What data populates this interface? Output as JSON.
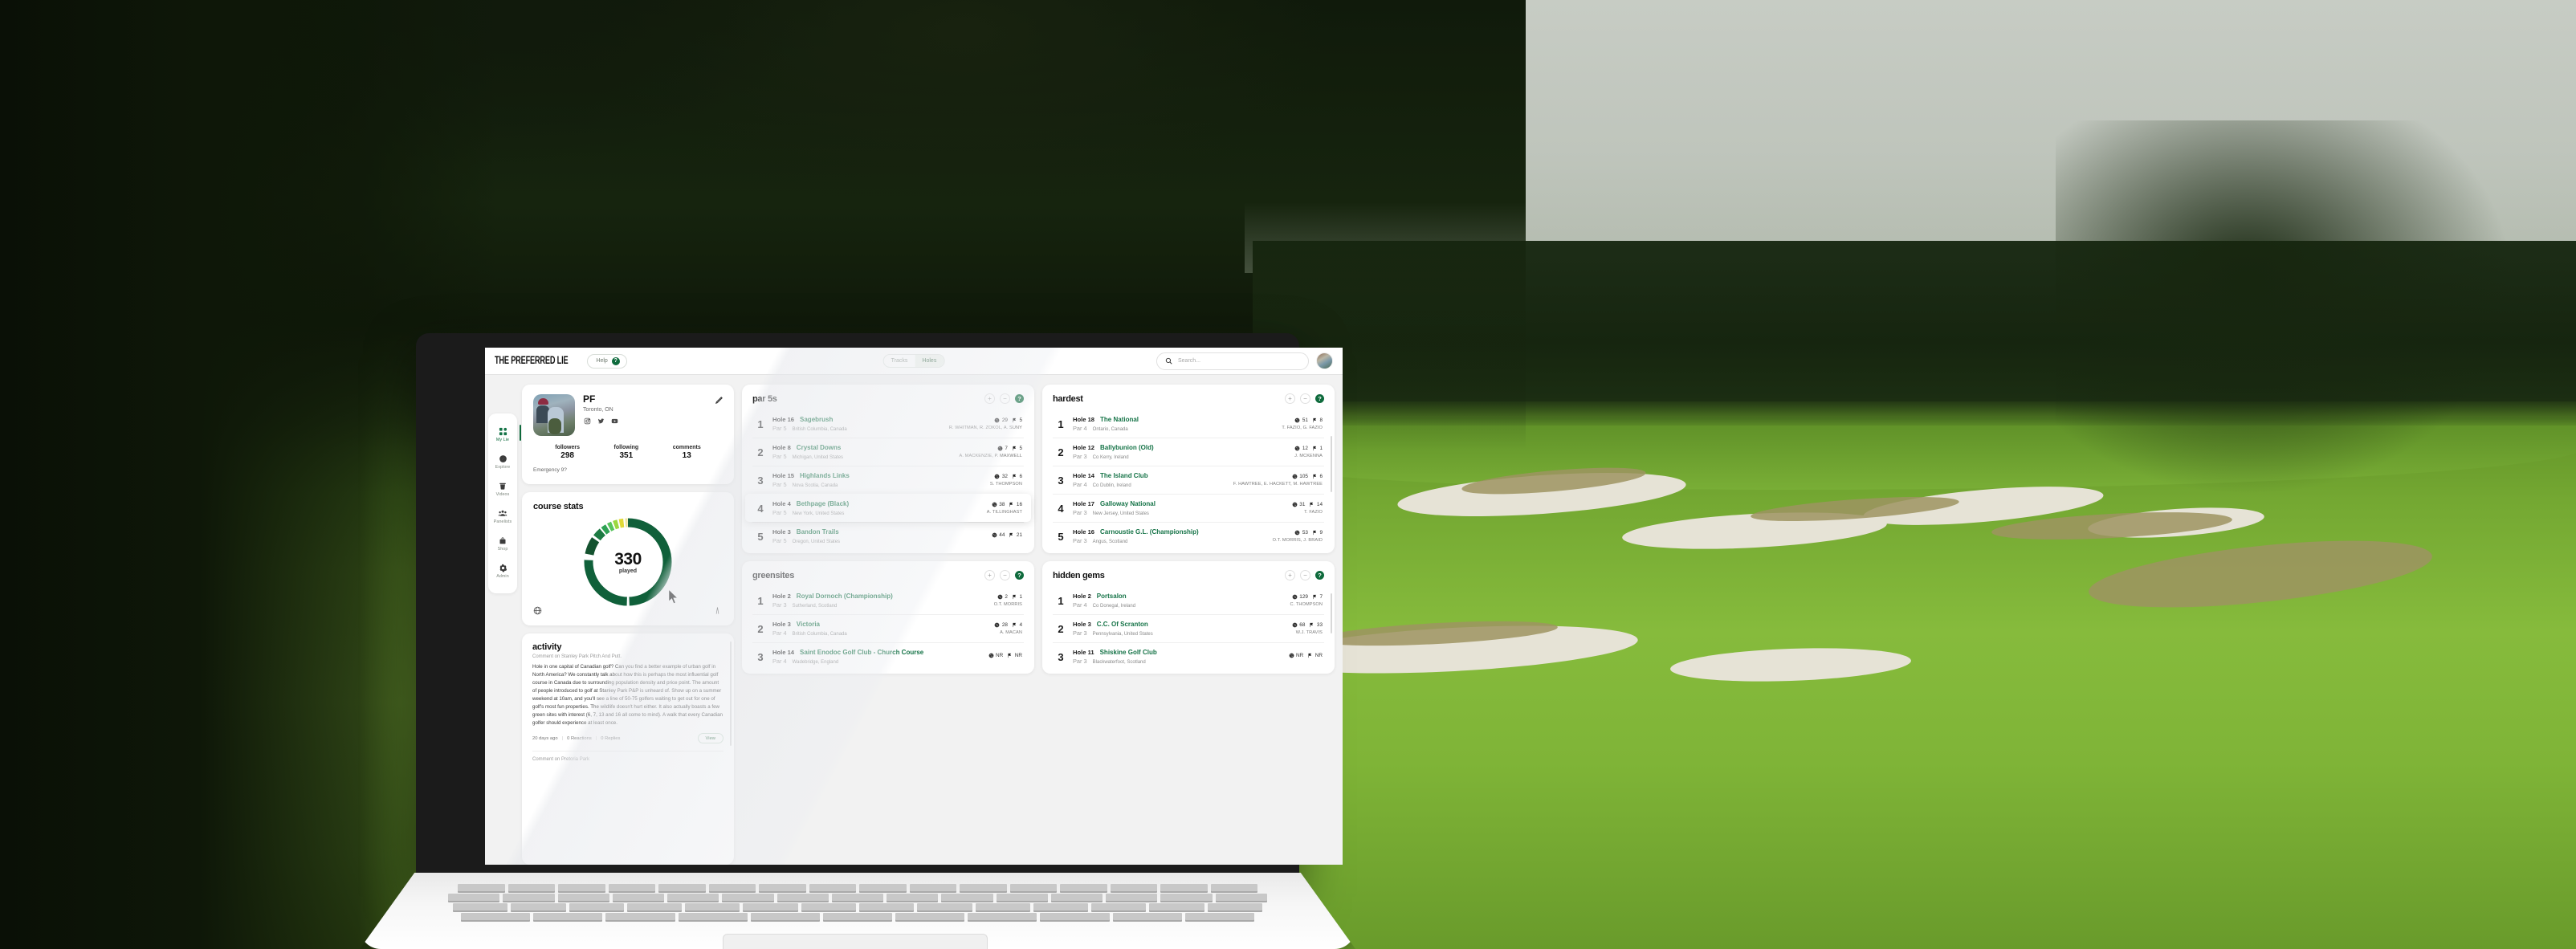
{
  "app": {
    "logo": "THE PREFERRED LIE",
    "help_label": "Help",
    "help_badge": "?",
    "toggle": {
      "left": "Tracks",
      "right": "Holes",
      "active": "Holes"
    },
    "search_placeholder": "Search...",
    "accent_green": "#157347",
    "dark_green": "#0f6b3d"
  },
  "sidebar": {
    "items": [
      {
        "label": "My Lie",
        "icon": "grid-icon",
        "active": true
      },
      {
        "label": "Explore",
        "icon": "compass-icon",
        "active": false
      },
      {
        "label": "Videos",
        "icon": "video-icon",
        "active": false
      },
      {
        "label": "Panelists",
        "icon": "people-icon",
        "active": false
      },
      {
        "label": "Shop",
        "icon": "bag-icon",
        "active": false
      },
      {
        "label": "Admin",
        "icon": "gear-icon",
        "active": false
      }
    ]
  },
  "profile": {
    "name": "PF",
    "location": "Toronto, ON",
    "socials": [
      "instagram-icon",
      "twitter-icon",
      "youtube-icon"
    ],
    "stats": [
      {
        "key": "followers",
        "value": "298"
      },
      {
        "key": "following",
        "value": "351"
      },
      {
        "key": "comments",
        "value": "13"
      }
    ],
    "tagline": "Emergency 9?"
  },
  "course_stats": {
    "title": "course stats",
    "value": "330",
    "unit": "played",
    "globe_icon": "globe-icon",
    "flag_icon": "flagstick-icon"
  },
  "chart_data": {
    "type": "pie",
    "title": "course stats",
    "center_value": 330,
    "center_label": "played",
    "categories": [
      "played-main",
      "tier-1",
      "tier-2",
      "tier-3",
      "tier-4",
      "tier-5",
      "tier-6",
      "tier-7"
    ],
    "values": [
      76,
      6,
      3,
      2.5,
      2.5,
      2.5,
      2.5,
      2.5
    ],
    "colors": [
      "#10603a",
      "#14522f",
      "#1c7a42",
      "#2fa254",
      "#57c45c",
      "#9bd83f",
      "#e0d936",
      "#efe6a0"
    ],
    "legend_position": "none",
    "grid": false
  },
  "activity": {
    "title": "activity",
    "subtitle": "Comment on Stanley Park Pitch And Putt.",
    "body": "Hole in one capital of Canadian golf? Can you find a better example of urban golf in North America? We constantly talk about how this is perhaps the most influential golf course in Canada due to surrounding population density and price point. The amount of people introduced to golf at Stanley Park P&P is unheard of. Show up on a summer weekend at 10am, and you'll see a line of 50-75 golfers waiting to get out for one of golf's most fun properties. The wildlife doesn't hurt either. It also actually boasts a few green sites with interest (6, 7, 13 and 16 all come to mind). A walk that every Canadian golfer should experience at least once.",
    "time": "20 days ago",
    "reactions": "0 Reactions",
    "replies": "0 Replies",
    "view_label": "View",
    "next_subtitle": "Comment on Pretoria Park"
  },
  "panels": [
    {
      "title": "par 5s",
      "add_label": "+",
      "remove_label": "−",
      "help_label": "?",
      "rows": [
        {
          "rank": "1",
          "hole": "Hole 16",
          "course": "Sagebrush",
          "par": "Par 5",
          "location": "British Columbia, Canada",
          "views": "29",
          "flags": "5",
          "architects": "R. WHITMAN, R. ZOKOL, A. SUNY",
          "highlighted": false
        },
        {
          "rank": "2",
          "hole": "Hole 8",
          "course": "Crystal Downs",
          "par": "Par 5",
          "location": "Michigan, United States",
          "views": "7",
          "flags": "5",
          "architects": "A. MACKENZIE, P. MAXWELL",
          "highlighted": false
        },
        {
          "rank": "3",
          "hole": "Hole 15",
          "course": "Highlands Links",
          "par": "Par 5",
          "location": "Nova Scotia, Canada",
          "views": "32",
          "flags": "6",
          "architects": "S. THOMPSON",
          "highlighted": false
        },
        {
          "rank": "4",
          "hole": "Hole 4",
          "course": "Bethpage (Black)",
          "par": "Par 5",
          "location": "New York, United States",
          "views": "38",
          "flags": "16",
          "architects": "A. TILLINGHAST",
          "highlighted": true
        },
        {
          "rank": "5",
          "hole": "Hole 3",
          "course": "Bandon Trails",
          "par": "Par 5",
          "location": "Oregon, United States",
          "views": "44",
          "flags": "21",
          "architects": "",
          "highlighted": false
        }
      ]
    },
    {
      "title": "hardest",
      "add_label": "+",
      "remove_label": "−",
      "help_label": "?",
      "rows": [
        {
          "rank": "1",
          "hole": "Hole 18",
          "course": "The National",
          "par": "Par 4",
          "location": "Ontario, Canada",
          "views": "51",
          "flags": "8",
          "architects": "T. FAZIO, G. FAZIO",
          "highlighted": false
        },
        {
          "rank": "2",
          "hole": "Hole 12",
          "course": "Ballybunion (Old)",
          "par": "Par 3",
          "location": "Co Kerry, Ireland",
          "views": "12",
          "flags": "1",
          "architects": "J. MCKENNA",
          "highlighted": false
        },
        {
          "rank": "3",
          "hole": "Hole 14",
          "course": "The Island Club",
          "par": "Par 4",
          "location": "Co Dublin, Ireland",
          "views": "105",
          "flags": "6",
          "architects": "F. HAWTREE, E. HACKETT, M. HAWTREE",
          "highlighted": false
        },
        {
          "rank": "4",
          "hole": "Hole 17",
          "course": "Galloway National",
          "par": "Par 3",
          "location": "New Jersey, United States",
          "views": "31",
          "flags": "14",
          "architects": "T. FAZIO",
          "highlighted": false
        },
        {
          "rank": "5",
          "hole": "Hole 16",
          "course": "Carnoustie G.L. (Championship)",
          "par": "Par 3",
          "location": "Angus, Scotland",
          "views": "53",
          "flags": "9",
          "architects": "O.T. MORRIS, J. BRAID",
          "highlighted": false
        }
      ]
    },
    {
      "title": "greensites",
      "add_label": "+",
      "remove_label": "−",
      "help_label": "?",
      "rows": [
        {
          "rank": "1",
          "hole": "Hole 2",
          "course": "Royal Dornoch (Championship)",
          "par": "Par 3",
          "location": "Sutherland, Scotland",
          "views": "2",
          "flags": "1",
          "architects": "O.T. MORRIS",
          "highlighted": false
        },
        {
          "rank": "2",
          "hole": "Hole 3",
          "course": "Victoria",
          "par": "Par 4",
          "location": "British Columbia, Canada",
          "views": "28",
          "flags": "4",
          "architects": "A. MACAN",
          "highlighted": false
        },
        {
          "rank": "3",
          "hole": "Hole 14",
          "course": "Saint Enodoc Golf Club - Church Course",
          "par": "Par 4",
          "location": "Wadebridge, England",
          "views": "NR",
          "flags": "NR",
          "architects": "",
          "highlighted": false
        }
      ]
    },
    {
      "title": "hidden gems",
      "add_label": "+",
      "remove_label": "−",
      "help_label": "?",
      "rows": [
        {
          "rank": "1",
          "hole": "Hole 2",
          "course": "Portsalon",
          "par": "Par 4",
          "location": "Co Donegal, Ireland",
          "views": "129",
          "flags": "7",
          "architects": "C. THOMPSON",
          "highlighted": false
        },
        {
          "rank": "2",
          "hole": "Hole 3",
          "course": "C.C. Of Scranton",
          "par": "Par 3",
          "location": "Pennsylvania, United States",
          "views": "68",
          "flags": "33",
          "architects": "W.J. TRAVIS",
          "highlighted": false
        },
        {
          "rank": "3",
          "hole": "Hole 11",
          "course": "Shiskine Golf Club",
          "par": "Par 3",
          "location": "Blackwaterfoot, Scotland",
          "views": "NR",
          "flags": "NR",
          "architects": "",
          "highlighted": false
        }
      ]
    }
  ]
}
